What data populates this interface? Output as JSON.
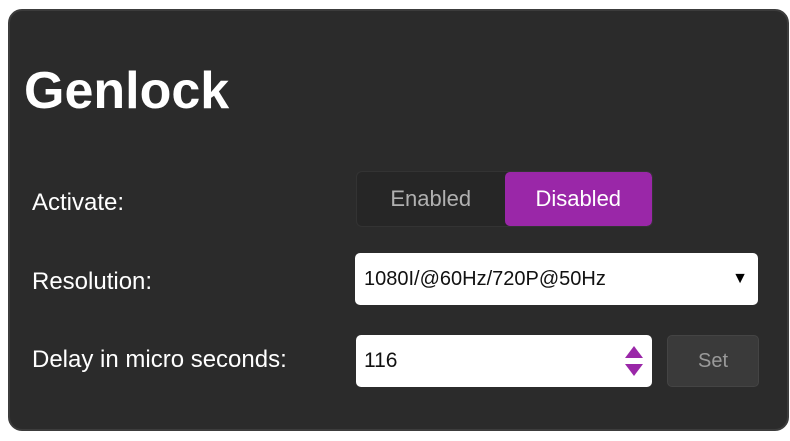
{
  "panel": {
    "title": "Genlock"
  },
  "activate": {
    "label": "Activate:",
    "options": [
      "Enabled",
      "Disabled"
    ],
    "selected": "Disabled"
  },
  "resolution": {
    "label": "Resolution:",
    "value": "1080I/@60Hz/720P@50Hz",
    "arrow_icon": "triangle-down-icon"
  },
  "delay": {
    "label": "Delay in micro seconds:",
    "value": "116",
    "spinner_icon": "up-down-arrows-icon",
    "set_label": "Set"
  },
  "colors": {
    "panel_bg": "#2b2b2b",
    "accent": "#9a27a8",
    "text": "#ffffff"
  }
}
